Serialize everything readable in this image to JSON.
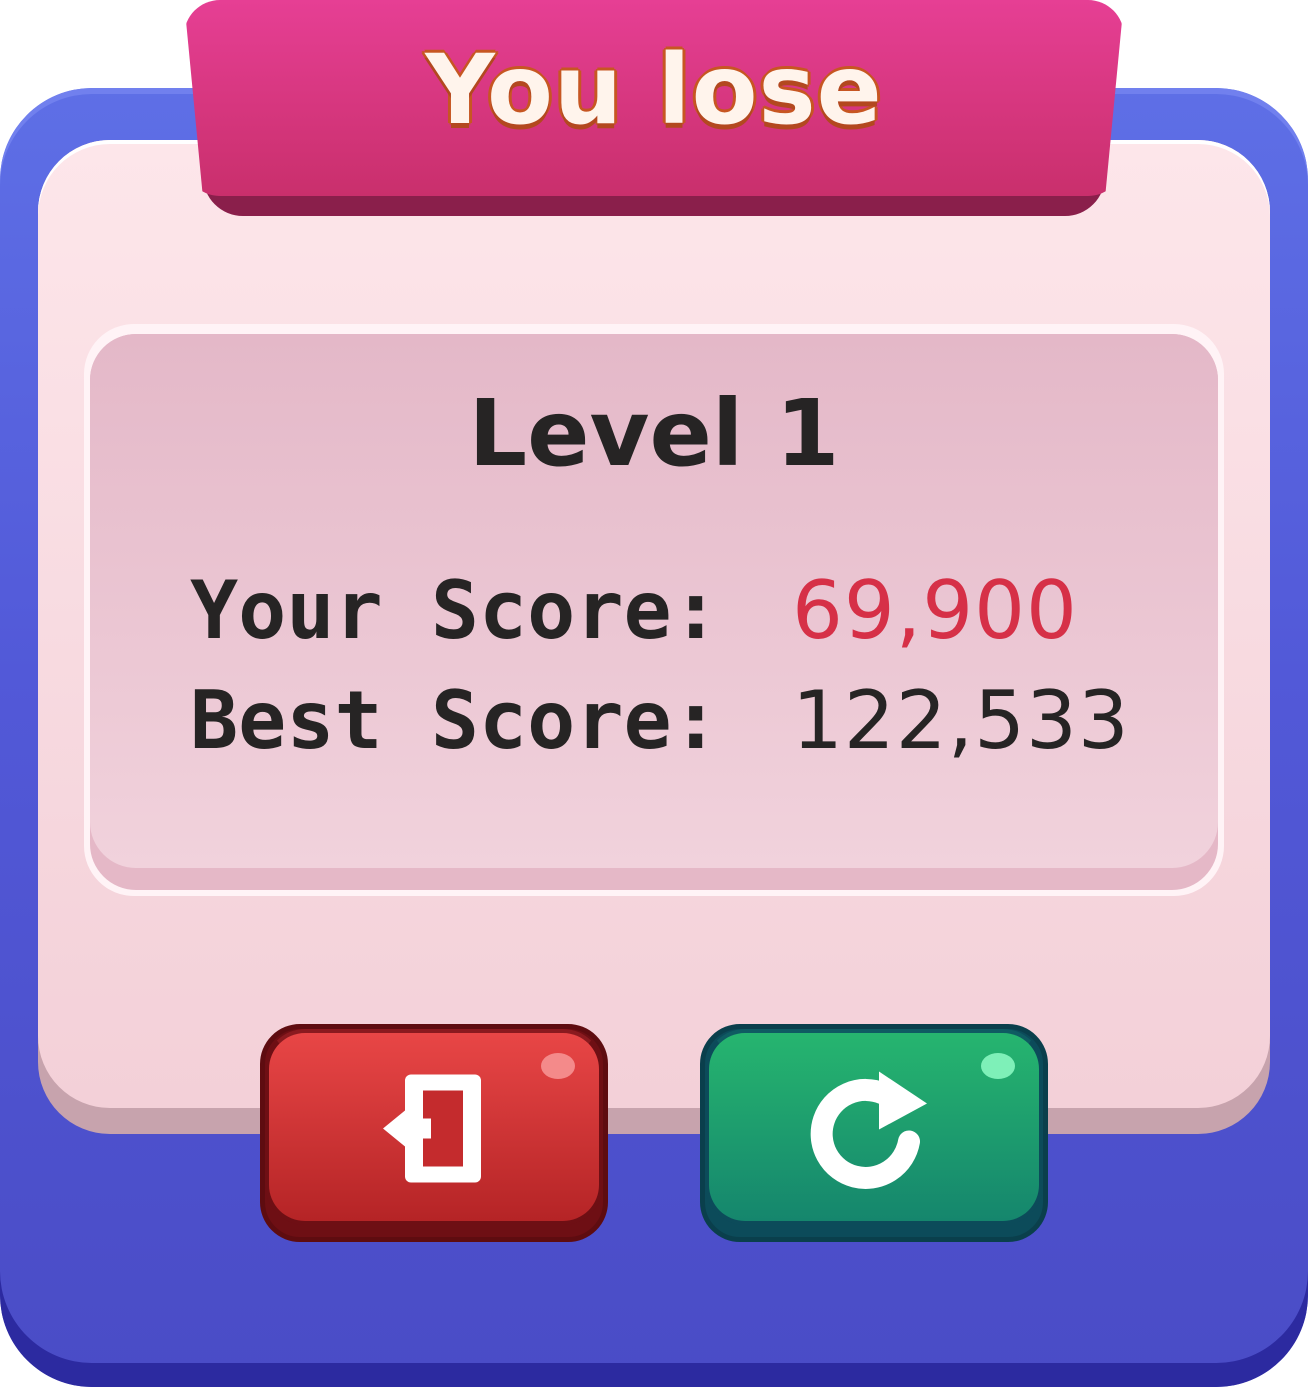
{
  "dialog": {
    "title": "You lose",
    "level_label": "Level 1",
    "scores": [
      {
        "label": "Your Score:",
        "value": "69,900"
      },
      {
        "label": "Best Score:",
        "value": "122,533"
      }
    ]
  },
  "buttons": {
    "exit": {
      "icon": "exit-door-icon"
    },
    "retry": {
      "icon": "restart-arrow-icon"
    }
  },
  "colors": {
    "frame": "#5259d8",
    "panel": "#fbe0e6",
    "banner": "#d8357f",
    "title_outline": "#c75622",
    "current_score": "#d63047",
    "exit_button": "#d43636",
    "retry_button": "#1ea26e"
  }
}
